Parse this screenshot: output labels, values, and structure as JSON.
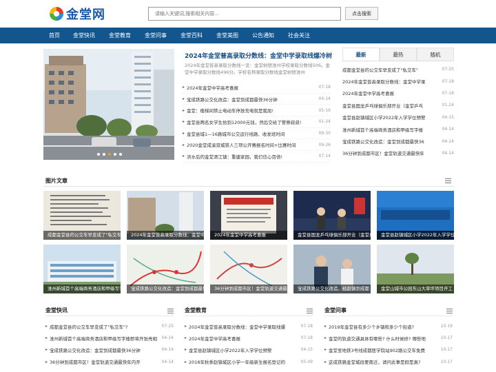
{
  "logo": {
    "text": "金堂网"
  },
  "search": {
    "placeholder": "请输入关键词,搜索相关内容...",
    "button": "点击搜索"
  },
  "nav": [
    "首页",
    "金堂快讯",
    "金堂教育",
    "金堂问事",
    "金堂百科",
    "金堂美图",
    "公告通知",
    "社会关注"
  ],
  "hero": {
    "title": "2024年金堂普高录取分数线：金堂中学录取线爆冷树",
    "desc": "2024年金堂普高录取分数线一览：金堂树德淮州学校录取分数线506。金堂中学录取分数线496分。学校名称录取分数线金堂树德淮州",
    "news": [
      {
        "title": "2024年金堂中学高考喜报",
        "date": "07-18"
      },
      {
        "title": "宝成铁路公交化改造：金堂到成都最快36分钟",
        "date": "04-14"
      },
      {
        "title": "金堂：楼梯间禁止电动车停放充电就是我屈!",
        "date": "05-16"
      },
      {
        "title": "金堂县两名女学生拾到12000元钱，然后交给了警察叔叔!",
        "date": "01-24"
      },
      {
        "title": "金堂县城1—16路城市公交运行线路、收发班时间",
        "date": "09-30"
      },
      {
        "title": "2020金堂成渝双城铁人三项公开赛报名时间+比赛时间",
        "date": "09-26"
      },
      {
        "title": "洪水后的金堂清江镇：重建家园，我们信心百倍!",
        "date": "07-14"
      }
    ]
  },
  "side": {
    "tabs": [
      "最新",
      "最热",
      "随机"
    ],
    "items": [
      {
        "title": "成都金堂县的公交车早变成了\"私交车\"",
        "date": "07-25"
      },
      {
        "title": "2024年金堂普高录取分数线：金堂中学录",
        "date": "07-18"
      },
      {
        "title": "2024年金堂中学高考喜报",
        "date": "07-18"
      },
      {
        "title": "金堂县国龙乒乓球俱乐部开业（金堂乒乓",
        "date": "01-24"
      },
      {
        "title": "金堂县赵镇城区小学2022年入学学位预警",
        "date": "04-15"
      },
      {
        "title": "淮州新城首个高端商务酒店和甲级写字楼",
        "date": "04-14"
      },
      {
        "title": "宝成铁路公交化改造：金堂到成都最快36",
        "date": "04-14"
      },
      {
        "title": "36分钟到成都市区！金堂轨道交通最快年",
        "date": "04-14"
      }
    ]
  },
  "gallery": {
    "title": "图片文章",
    "items": [
      "成都金堂县的公交车早变成了\"私交车\"",
      "2024年金堂普高录取分数线：金堂中学录取线爆冷",
      "2024年金堂中学高考喜报",
      "金堂县国龙乒乓球俱乐部开业（金堂乒乓球）",
      "金堂县赵镇城区小学2022年入学学位预警",
      "淮州新城首个高端商务酒店和甲级写字楼",
      "宝成铁路公交化改造：金堂到成都最快36分钟",
      "36分钟到成都市区！金堂轨道交通最快年内开",
      "宝成铁路公交化改造，经赵镇到成都",
      "金堂山城市公园东山大草坪项目开工"
    ]
  },
  "columns": [
    {
      "title": "金堂快讯",
      "items": [
        {
          "title": "成都金堂县的公交车早变成了\"私交车\"?",
          "date": "07-25"
        },
        {
          "title": "淮州新城首个高端商务酒店和甲级写字楼即将开张亮相",
          "date": "04-14"
        },
        {
          "title": "宝成铁路公交化改造：金堂到成都最快36分钟",
          "date": "04-14"
        },
        {
          "title": "36分钟到成都市区！金堂轨道交通最快年内开",
          "date": "04-14"
        }
      ]
    },
    {
      "title": "金堂教育",
      "items": [
        {
          "title": "2024年金堂普高录取分数线：金堂中学录取线爆",
          "date": "07-18"
        },
        {
          "title": "2024年金堂中学高考喜报",
          "date": "07-18"
        },
        {
          "title": "金堂县赵镇城区小学2022年入学学位预警",
          "date": "04-15"
        },
        {
          "title": "2018年秋季赵镇城区小学一年级新生报名登记的",
          "date": "05-09"
        }
      ]
    },
    {
      "title": "金堂问事",
      "items": [
        {
          "title": "2019年金堂县有多少个乡镇和多少个街道?",
          "date": "10-19"
        },
        {
          "title": "金堂的轨道交通具体有哪些? 什么时候修? 哪些地",
          "date": "10-17"
        },
        {
          "title": "金堂至地铁3号线成都医学院站902路公交车免费",
          "date": "10-17"
        },
        {
          "title": "这成铁路金堂城段要南迁，请问此事是假是真?",
          "date": "10-17"
        }
      ]
    }
  ],
  "colors": {
    "nav_bg": "#13558d",
    "title_blue": "#1a4f86",
    "date_gray": "#999999"
  }
}
